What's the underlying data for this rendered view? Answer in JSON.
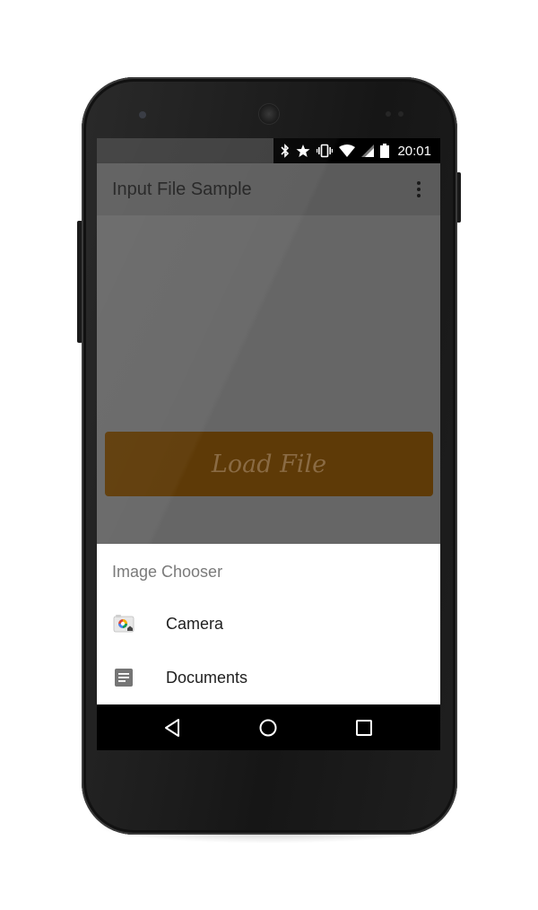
{
  "status_bar": {
    "time": "20:01",
    "icons": [
      "bluetooth-icon",
      "star-icon",
      "vibrate-icon",
      "wifi-icon",
      "cellular-signal-icon",
      "battery-icon"
    ]
  },
  "app_bar": {
    "title": "Input File Sample",
    "overflow_icon": "more-vert-icon"
  },
  "main": {
    "load_button_label": "Load File",
    "load_button_color": "#5e3a07"
  },
  "chooser": {
    "title": "Image Chooser",
    "items": [
      {
        "label": "Camera",
        "icon": "camera-app-icon"
      },
      {
        "label": "Documents",
        "icon": "documents-icon"
      }
    ]
  },
  "nav_bar": {
    "buttons": [
      "back-icon",
      "home-icon",
      "recents-icon"
    ]
  }
}
